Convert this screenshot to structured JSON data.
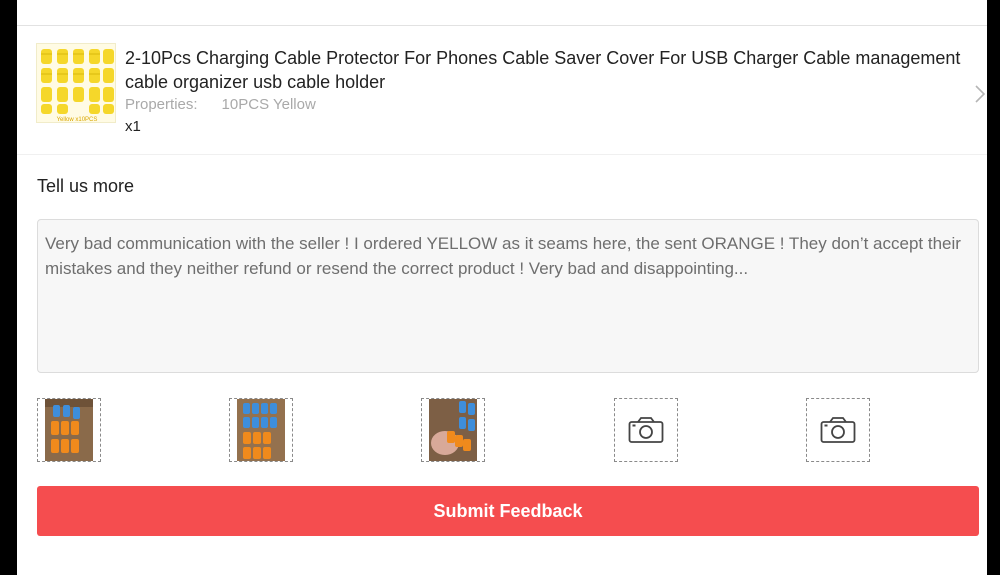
{
  "product": {
    "title": "2-10Pcs Charging Cable Protector For Phones Cable Saver Cover For USB Charger Cable management cable organizer usb cable holder",
    "properties_label": "Properties:",
    "properties_value": "10PCS Yellow",
    "quantity": "x1",
    "thumbnail_caption": "Yellow x10PCS"
  },
  "feedback": {
    "label": "Tell us more",
    "text": "Very bad communication with the seller ! I ordered YELLOW as it seams here, the sent ORANGE ! They don’t accept their mistakes and they neither refund or resend the correct product ! Very bad and disappointing..."
  },
  "photos": [
    {
      "type": "image",
      "icon": "photo-thumbnail"
    },
    {
      "type": "image",
      "icon": "photo-thumbnail"
    },
    {
      "type": "image",
      "icon": "photo-thumbnail"
    },
    {
      "type": "add",
      "icon": "camera-icon"
    },
    {
      "type": "add",
      "icon": "camera-icon"
    }
  ],
  "submit_label": "Submit Feedback",
  "colors": {
    "submit": "#f54d4f",
    "product_yellow": "#f5d72a",
    "photo_orange": "#f08a1c",
    "photo_blue": "#3e8edb"
  }
}
